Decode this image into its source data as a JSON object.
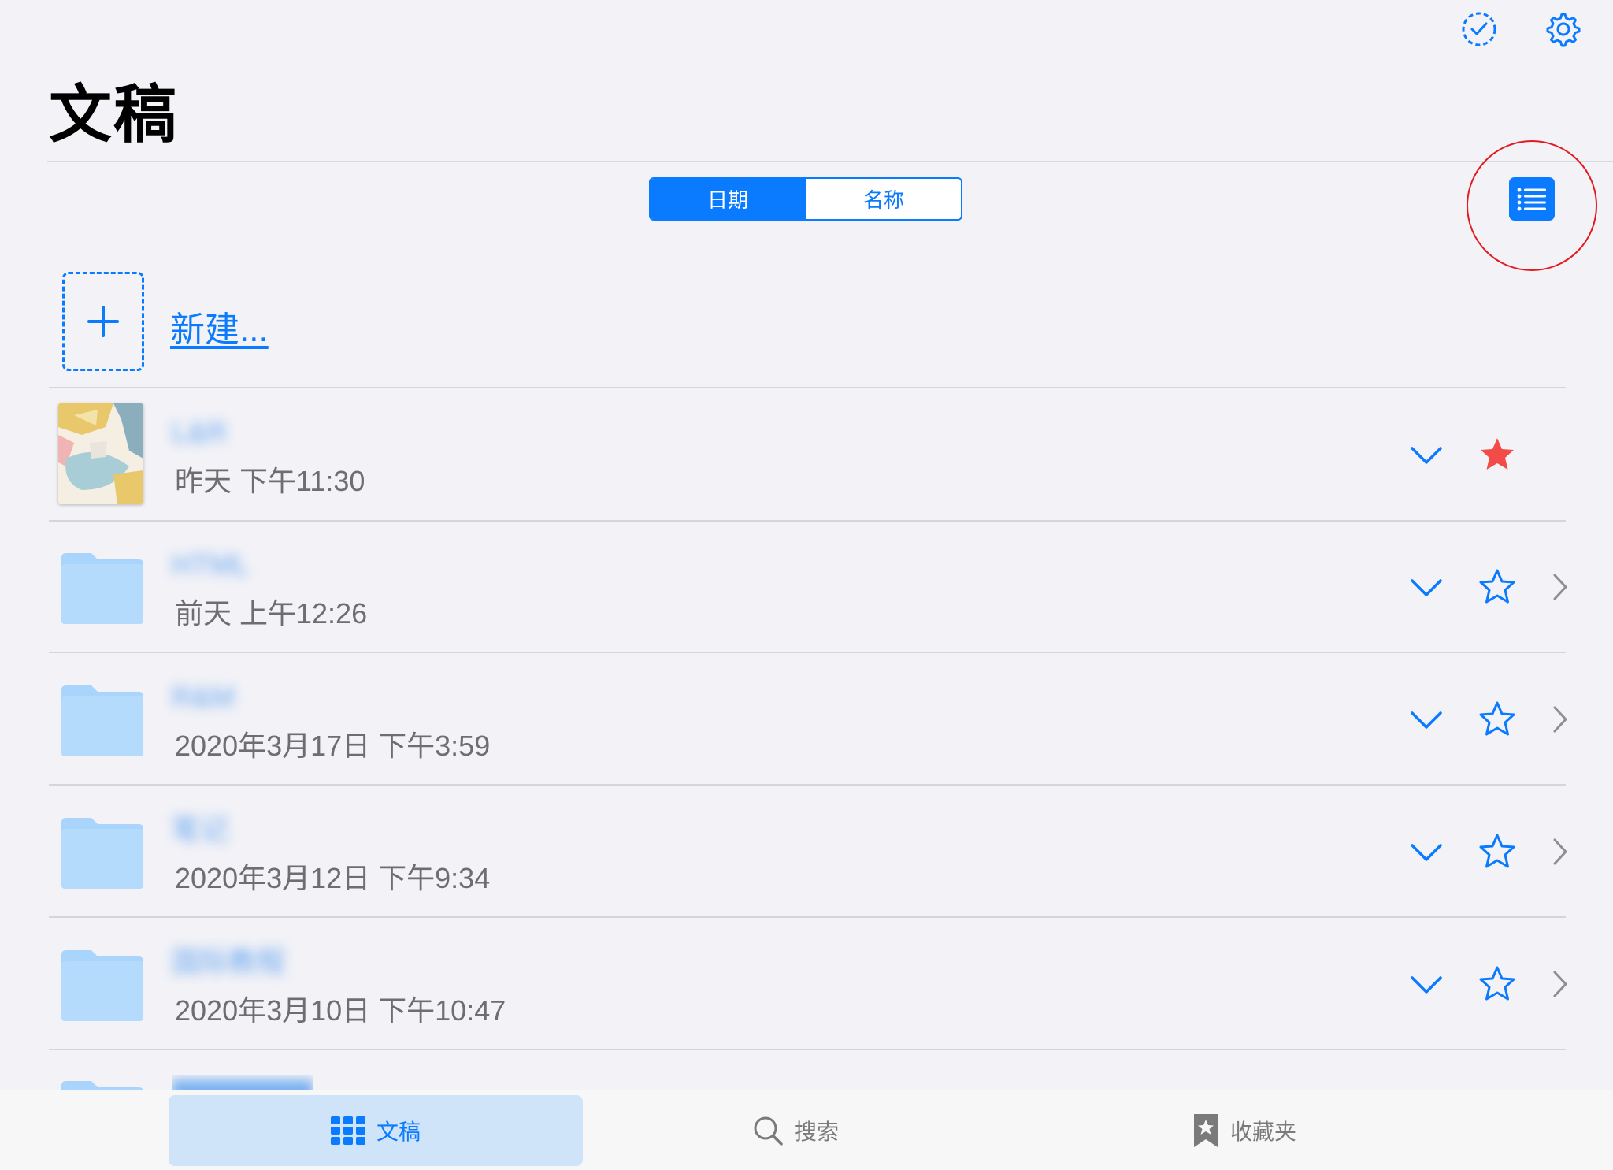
{
  "header": {
    "title": "文稿",
    "select_icon": "checkmark-circle-dashed-icon",
    "settings_icon": "gear-icon"
  },
  "sort": {
    "options": [
      "日期",
      "名称"
    ],
    "selected": "日期"
  },
  "view_toggle_icon": "list-view-icon",
  "new_document": {
    "label": "新建...",
    "icon": "plus-icon"
  },
  "items": [
    {
      "type": "document",
      "name": "L&R",
      "date": "昨天 下午11:30",
      "favorite": true
    },
    {
      "type": "folder",
      "name": "HTML",
      "date": "前天 上午12:26",
      "favorite": false
    },
    {
      "type": "folder",
      "name": "R&M",
      "date": "2020年3月17日 下午3:59",
      "favorite": false
    },
    {
      "type": "folder",
      "name": "笔记",
      "date": "2020年3月12日 下午9:34",
      "favorite": false
    },
    {
      "type": "folder",
      "name": "国际教程",
      "date": "2020年3月10日 下午10:47",
      "favorite": false
    }
  ],
  "tabbar": {
    "tabs": [
      {
        "label": "文稿",
        "icon": "grid-icon",
        "active": true
      },
      {
        "label": "搜索",
        "icon": "magnifier-icon",
        "active": false
      },
      {
        "label": "收藏夹",
        "icon": "bookmark-star-icon",
        "active": false
      }
    ]
  },
  "colors": {
    "accent": "#0a7aff",
    "favorite": "#f24b48",
    "folder": "#a9d4fb",
    "annotation": "#e3191e"
  }
}
